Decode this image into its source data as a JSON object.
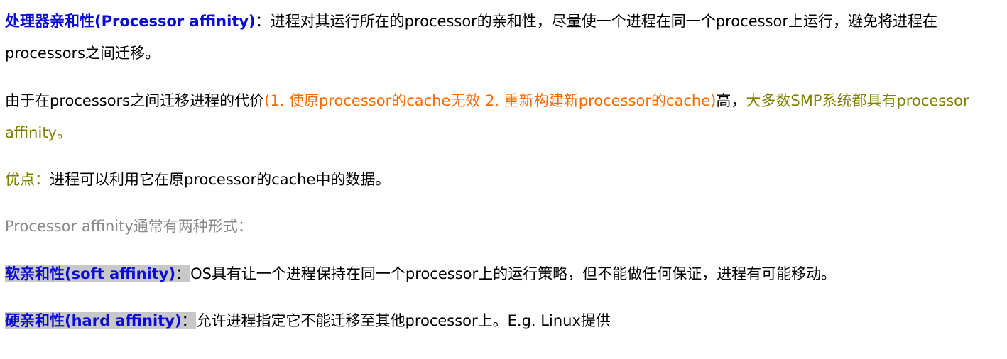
{
  "p1": {
    "term": "处理器亲和性(Processor affinity)",
    "colon": "：",
    "text": "进程对其运行所在的processor的亲和性，尽量使一个进程在同一个processor上运行，避免将进程在processors之间迁移。"
  },
  "p2": {
    "text_a": "由于在processors之间迁移进程的代价",
    "cost": "(1. 使原processor的cache无效 2. 重新构建新processor的cache)",
    "text_b": "高，",
    "conclusion": "大多数SMP系统都具有processor affinity。"
  },
  "p3": {
    "label": "优点：",
    "text": "进程可以利用它在原processor的cache中的数据。"
  },
  "p4": {
    "text": "Processor affinity通常有两种形式："
  },
  "p5": {
    "term": "软亲和性(soft affinity)",
    "colon": "：",
    "text": "OS具有让一个进程保持在同一个processor上的运行策略，但不能做任何保证，进程有可能移动。"
  },
  "p6": {
    "term": "硬亲和性(hard affinity)",
    "colon": "：",
    "text": "允许进程指定它不能迁移至其他processor上。E.g. Linux提供"
  },
  "colors": {
    "term_blue": "#0b0bd8",
    "cost_orange": "#ff6a00",
    "olive": "#808000",
    "gray": "#8a8a8a",
    "highlight": "#c8c8c8"
  }
}
